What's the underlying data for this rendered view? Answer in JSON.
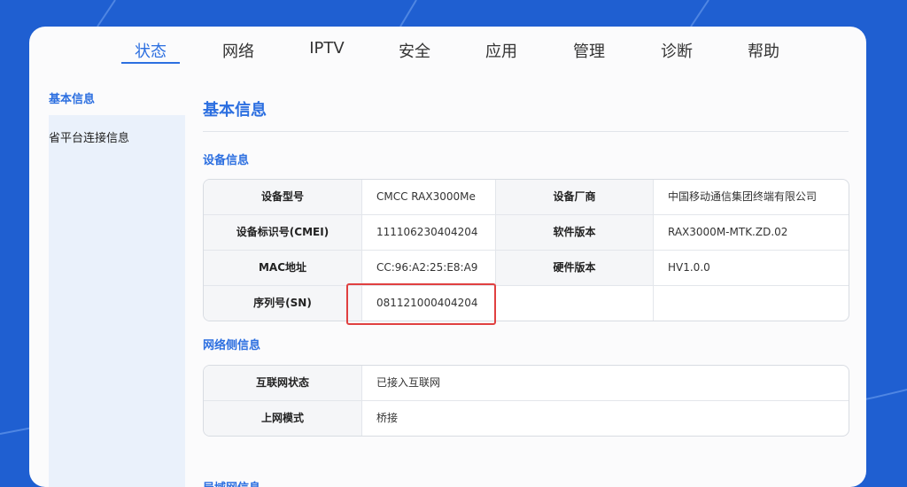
{
  "nav": {
    "tabs": [
      {
        "label": "状态",
        "active": true
      },
      {
        "label": "网络",
        "active": false
      },
      {
        "label": "IPTV",
        "active": false
      },
      {
        "label": "安全",
        "active": false
      },
      {
        "label": "应用",
        "active": false
      },
      {
        "label": "管理",
        "active": false
      },
      {
        "label": "诊断",
        "active": false
      },
      {
        "label": "帮助",
        "active": false
      }
    ]
  },
  "sidebar": {
    "items": [
      {
        "label": "基本信息",
        "active": true
      },
      {
        "label": "省平台连接信息",
        "active": false
      }
    ]
  },
  "main": {
    "title": "基本信息",
    "device_section": "设备信息",
    "device_rows": [
      {
        "l1": "设备型号",
        "v1": "CMCC RAX3000Me",
        "l2": "设备厂商",
        "v2": "中国移动通信集团终端有限公司"
      },
      {
        "l1": "设备标识号(CMEI)",
        "v1": "111106230404204",
        "l2": "软件版本",
        "v2": "RAX3000M-MTK.ZD.02"
      },
      {
        "l1": "MAC地址",
        "v1": "CC:96:A2:25:E8:A9",
        "l2": "硬件版本",
        "v2": "HV1.0.0"
      },
      {
        "l1": "序列号(SN)",
        "v1": "081121000404204",
        "l2": "",
        "v2": ""
      }
    ],
    "network_section": "网络侧信息",
    "network_rows": [
      {
        "l": "互联网状态",
        "v": "已接入互联网"
      },
      {
        "l": "上网模式",
        "v": "桥接"
      }
    ],
    "lan_section": "局域网信息"
  },
  "colors": {
    "accent": "#2c6fe0",
    "background": "#1f5fd1",
    "highlight": "#e04040"
  }
}
